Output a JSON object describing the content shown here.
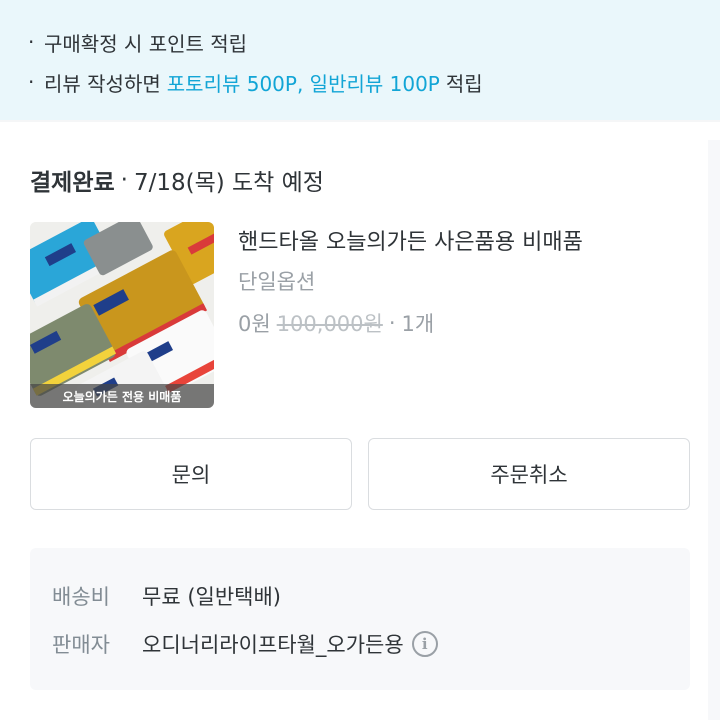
{
  "notice": {
    "bullet": "·",
    "line1": "구매확정 시 포인트 적립",
    "line2_prefix": "리뷰 작성하면",
    "line2_highlight": "포토리뷰 500P, 일반리뷰 100P",
    "line2_suffix": "적립",
    "highlight_color": "#12a5d6"
  },
  "order": {
    "status": "결제완료",
    "separator": "·",
    "delivery": "7/18(목) 도착 예정"
  },
  "product": {
    "image_caption": "오늘의가든 전용 비매품",
    "name": "핸드타올 오늘의가든 사은품용 비매품",
    "option": "단일옵션",
    "price": "0원",
    "original_price": "100,000원",
    "quantity": "1개",
    "separator": "·"
  },
  "buttons": {
    "inquiry": "문의",
    "cancel": "주문취소"
  },
  "info": {
    "shipping_label": "배송비",
    "shipping_value": "무료 (일반택배)",
    "seller_label": "판매자",
    "seller_value": "오디너리라이프타월_오가든용",
    "info_icon": "i"
  }
}
